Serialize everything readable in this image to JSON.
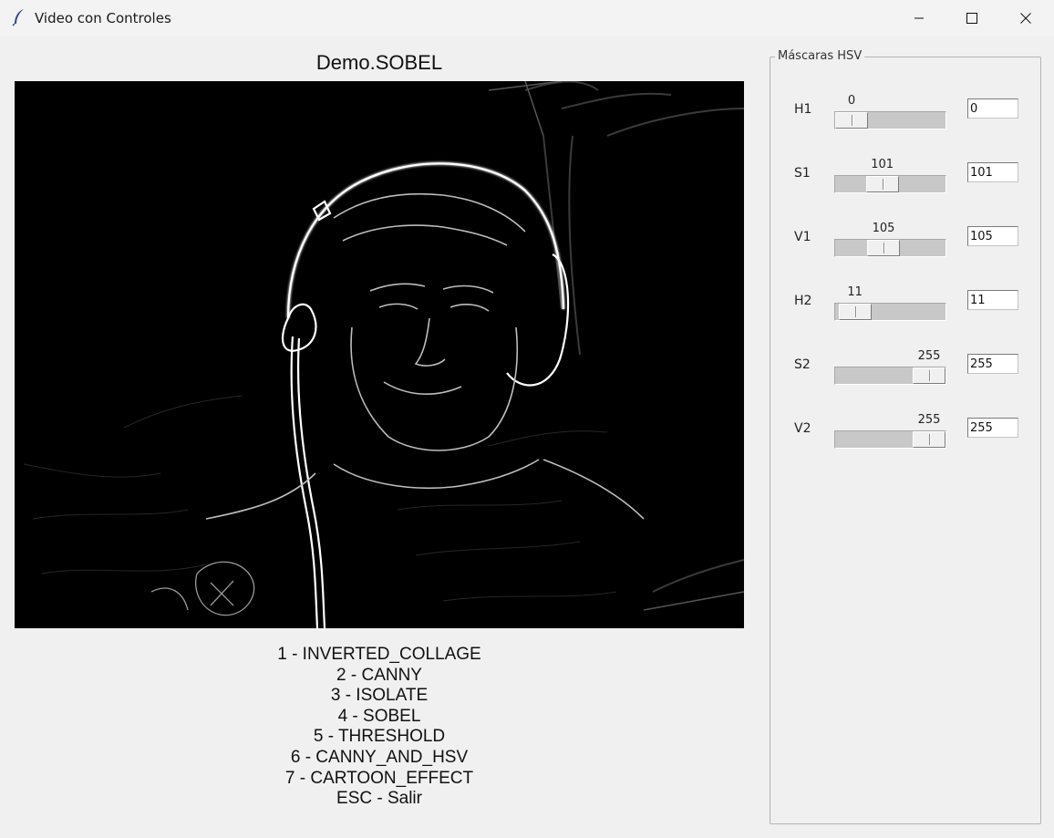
{
  "window": {
    "title": "Video con Controles"
  },
  "main": {
    "demo_title": "Demo.SOBEL",
    "menu": [
      "1 - INVERTED_COLLAGE",
      "2 - CANNY",
      "3 - ISOLATE",
      "4 - SOBEL",
      "5 - THRESHOLD",
      "6 - CANNY_AND_HSV",
      "7 - CARTOON_EFFECT",
      "ESC - Salir"
    ]
  },
  "hsv": {
    "group_label": "Máscaras HSV",
    "range_max": 255,
    "rows": [
      {
        "label": "H1",
        "value": "0",
        "entry": "0"
      },
      {
        "label": "S1",
        "value": "101",
        "entry": "101"
      },
      {
        "label": "V1",
        "value": "105",
        "entry": "105"
      },
      {
        "label": "H2",
        "value": "11",
        "entry": "11"
      },
      {
        "label": "S2",
        "value": "255",
        "entry": "255"
      },
      {
        "label": "V2",
        "value": "255",
        "entry": "255"
      }
    ]
  }
}
